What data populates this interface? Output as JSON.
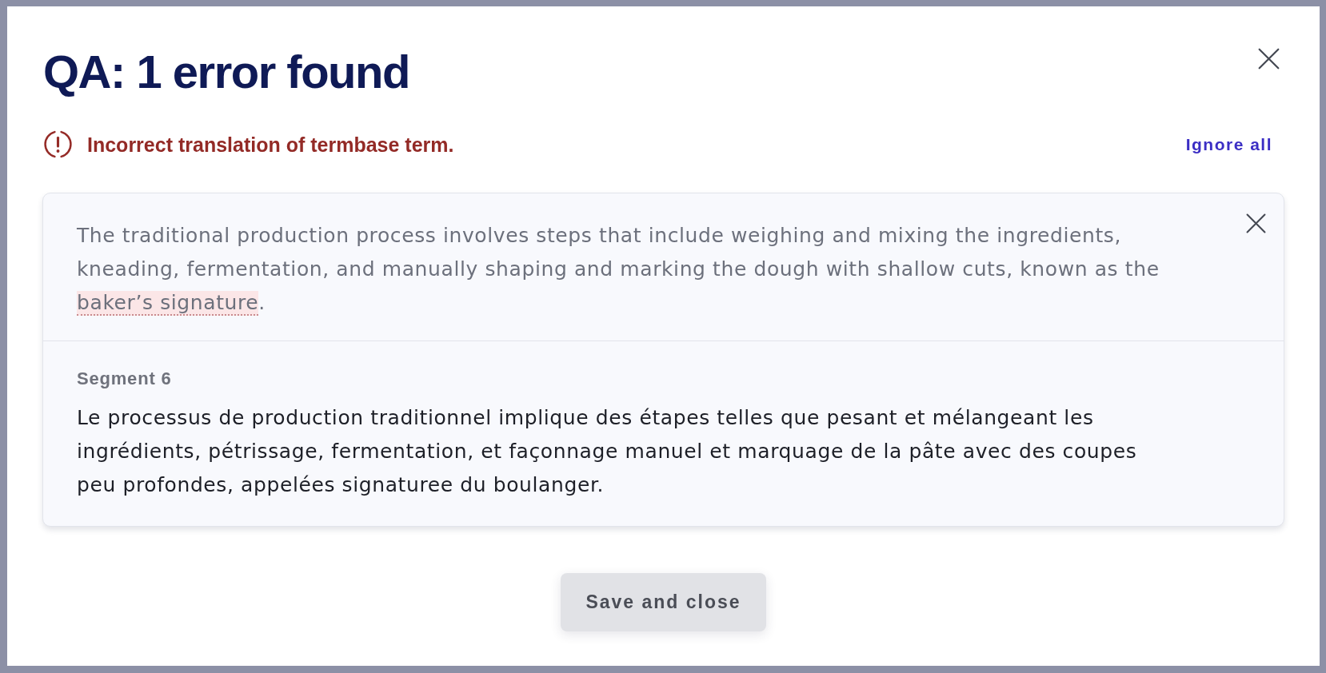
{
  "dialog": {
    "title": "QA: 1 error found"
  },
  "issue": {
    "message": "Incorrect translation of termbase term.",
    "action": "Ignore all"
  },
  "segment": {
    "source": [
      {
        "text": "The traditional production process involves steps that include weighing and mixing the ingredients, kneading, fermentation, and manually shaping and marking the dough with shallow cuts, known as the ",
        "highlighted": false
      },
      {
        "text": "baker’s signature",
        "highlighted": true
      },
      {
        "text": ".",
        "highlighted": false
      }
    ],
    "label": "Segment 6",
    "target": "Le processus de production traditionnel implique des étapes telles que pesant et mélangeant les ingrédients, pétrissage, fermentation, et façonnage manuel et marquage de la pâte avec des coupes peu profondes, appelées signaturee du boulanger."
  },
  "buttons": [
    {
      "label": "Save and close"
    }
  ]
}
